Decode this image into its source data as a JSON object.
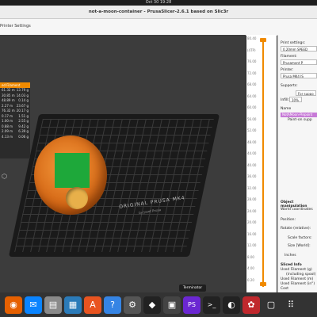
{
  "system": {
    "clock": "Oct 30  19:28"
  },
  "window": {
    "title": "not-a-moon-container - PrusaSlicer-2.6.1 based on Slic3r"
  },
  "menubar": {
    "tab": "Printer Settings"
  },
  "info_panel": {
    "header": "ed Filament",
    "rows": [
      [
        "61.32 m",
        "13.79 g"
      ],
      [
        "30.85 m",
        "14.03 g"
      ],
      [
        "48.89 m",
        "0.14 g"
      ],
      [
        "2.27 m",
        "23.67 g"
      ],
      [
        "76.32 m",
        "20.17 g"
      ],
      [
        "0.17 m",
        "1.51 g"
      ],
      [
        "1.00 m",
        "2.55 g"
      ],
      [
        "0.88 m",
        "9.42 g"
      ],
      [
        "2.09 m",
        "6.39 g"
      ],
      [
        "4.13 m",
        "0.06 g"
      ]
    ]
  },
  "bed": {
    "brand": "ORIGINAL PRUSA MK4",
    "sub": "by Josef Prusa"
  },
  "ruler": {
    "labels": [
      "80.40",
      "(4TP)",
      "76.00",
      "72.00",
      "68.00",
      "64.00",
      "60.00",
      "56.00",
      "52.00",
      "48.00",
      "44.00",
      "40.00",
      "36.00",
      "32.00",
      "28.00",
      "24.00",
      "20.00",
      "16.00",
      "12.00",
      "8.00",
      "4.00",
      "0.20"
    ]
  },
  "sidebar": {
    "print_settings_label": "Print settings:",
    "print_value": "0.20mm SPEED",
    "filament_label": "Filament:",
    "filament_value": "Prusament P",
    "printer_label": "Printer:",
    "printer_value": "Prusa MK4 IS",
    "supports_label": "Supports:",
    "supports_value": "For suppo",
    "infill_label": "Infill:",
    "infill_value": "10%",
    "name_header": "Name",
    "object_name": "NotAMoon-Pinpoint",
    "paint_label": "Paint-on supp",
    "obj_manip": "Object manipulation",
    "world_coords": "World coordinates",
    "position": "Position:",
    "rotate": "Rotate (relative):",
    "scale_factors": "Scale factors:",
    "size": "Size [World]:",
    "inches": "Inches",
    "sliced_info": "Sliced Info",
    "used_g": "Used Filament (g)",
    "incl_spool": "(including spool)",
    "used_m": "Used Filament (m)",
    "used_in": "Used Filament (in\")",
    "cost": "Cost"
  },
  "tooltip": "Terminator",
  "dock": {
    "apps": [
      {
        "name": "firefox-icon",
        "glyph": "◉",
        "color": "#e66000"
      },
      {
        "name": "thunderbird-icon",
        "glyph": "✉",
        "color": "#0a84ff"
      },
      {
        "name": "files-icon",
        "glyph": "▤",
        "color": "#8a8a8a"
      },
      {
        "name": "libreoffice-icon",
        "glyph": "▦",
        "color": "#2b7bb9"
      },
      {
        "name": "appcenter-icon",
        "glyph": "A",
        "color": "#e95420"
      },
      {
        "name": "help-icon",
        "glyph": "?",
        "color": "#3584e4"
      },
      {
        "name": "settings-icon",
        "glyph": "⚙",
        "color": "#555"
      },
      {
        "name": "inkscape-icon",
        "glyph": "◆",
        "color": "#222"
      },
      {
        "name": "photos-icon",
        "glyph": "▣",
        "color": "#444"
      },
      {
        "name": "phpstorm-icon",
        "glyph": "PS",
        "color": "#6b27d2"
      },
      {
        "name": "terminal-icon",
        "glyph": ">_",
        "color": "#222"
      },
      {
        "name": "prusaslicer-icon",
        "glyph": "◐",
        "color": "#222"
      },
      {
        "name": "gear-icon",
        "glyph": "✿",
        "color": "#c0282d"
      },
      {
        "name": "screen-icon",
        "glyph": "▢",
        "color": "#333"
      },
      {
        "name": "app-grid-icon",
        "glyph": "⠿",
        "color": "#333"
      }
    ]
  }
}
